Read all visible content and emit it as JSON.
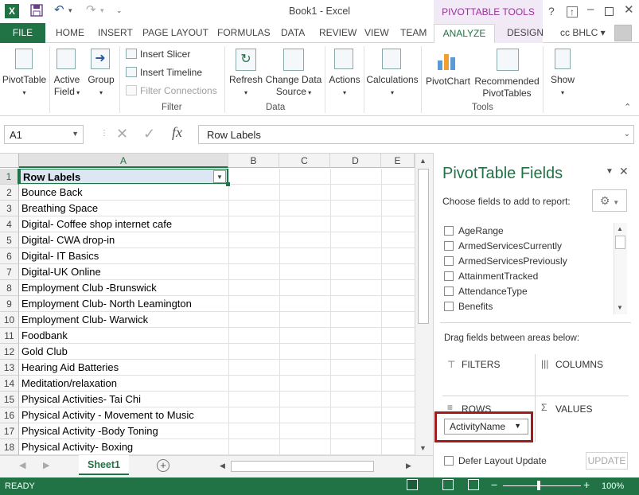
{
  "app": {
    "title": "Book1 - Excel",
    "context_tools": "PIVOTTABLE TOOLS",
    "user": "cc BHLC"
  },
  "tabs": [
    "FILE",
    "HOME",
    "INSERT",
    "PAGE LAYOUT",
    "FORMULAS",
    "DATA",
    "REVIEW",
    "VIEW",
    "TEAM",
    "ANALYZE",
    "DESIGN"
  ],
  "ribbon": {
    "pivottable": "PivotTable",
    "active_field_1": "Active",
    "active_field_2": "Field",
    "group": "Group",
    "insert_slicer": "Insert Slicer",
    "insert_timeline": "Insert Timeline",
    "filter_connections": "Filter Connections",
    "filter_group": "Filter",
    "refresh": "Refresh",
    "change_source_1": "Change Data",
    "change_source_2": "Source",
    "data_group": "Data",
    "actions": "Actions",
    "calculations": "Calculations",
    "pivotchart": "PivotChart",
    "recommended_1": "Recommended",
    "recommended_2": "PivotTables",
    "tools_group": "Tools",
    "show": "Show"
  },
  "formula_bar": {
    "name_box": "A1",
    "formula": "Row Labels"
  },
  "grid": {
    "columns": [
      "A",
      "B",
      "C",
      "D",
      "E"
    ],
    "rows": [
      {
        "n": "1",
        "a": "Row Labels"
      },
      {
        "n": "2",
        "a": "Bounce Back"
      },
      {
        "n": "3",
        "a": "Breathing Space"
      },
      {
        "n": "4",
        "a": "Digital- Coffee shop internet cafe"
      },
      {
        "n": "5",
        "a": "Digital- CWA drop-in"
      },
      {
        "n": "6",
        "a": "Digital- IT Basics"
      },
      {
        "n": "7",
        "a": "Digital-UK Online"
      },
      {
        "n": "8",
        "a": "Employment Club -Brunswick"
      },
      {
        "n": "9",
        "a": "Employment Club- North Leamington"
      },
      {
        "n": "10",
        "a": "Employment Club- Warwick"
      },
      {
        "n": "11",
        "a": "Foodbank"
      },
      {
        "n": "12",
        "a": "Gold Club"
      },
      {
        "n": "13",
        "a": "Hearing Aid Batteries"
      },
      {
        "n": "14",
        "a": "Meditation/relaxation"
      },
      {
        "n": "15",
        "a": "Physical Activities- Tai Chi"
      },
      {
        "n": "16",
        "a": "Physical Activity - Movement to Music"
      },
      {
        "n": "17",
        "a": "Physical Activity -Body Toning"
      },
      {
        "n": "18",
        "a": "Physical Activity- Boxing"
      }
    ]
  },
  "sheet": {
    "tab": "Sheet1"
  },
  "status": {
    "ready": "READY",
    "zoom": "100%"
  },
  "pane": {
    "title": "PivotTable Fields",
    "choose": "Choose fields to add to report:",
    "fields": [
      "AgeRange",
      "ArmedServicesCurrently",
      "ArmedServicesPreviously",
      "AttainmentTracked",
      "AttendanceType",
      "Benefits"
    ],
    "drag": "Drag fields between areas below:",
    "filters": "FILTERS",
    "columns": "COLUMNS",
    "rows": "ROWS",
    "values": "VALUES",
    "row_field": "ActivityName",
    "defer": "Defer Layout Update",
    "update": "UPDATE"
  },
  "colors": {
    "excel_green": "#217346",
    "context": "#9d2f9c",
    "highlight": "#a01c1c"
  }
}
